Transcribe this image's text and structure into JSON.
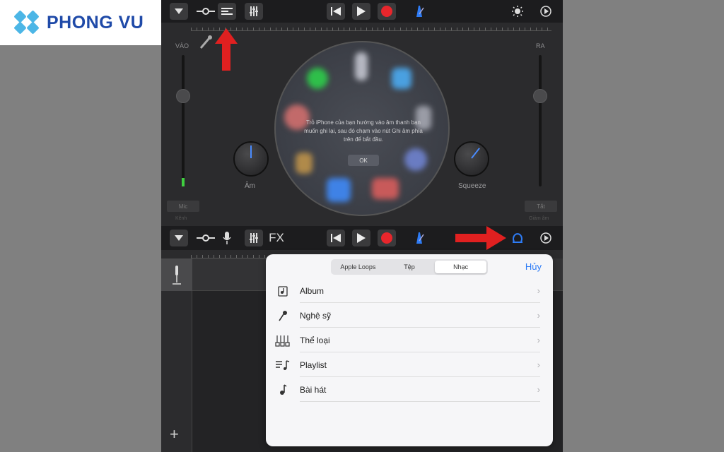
{
  "logo": {
    "text": "PHONG VU"
  },
  "input_panel": {
    "in_label": "VÀO",
    "out_label": "RA",
    "tone_label": "Âm",
    "squeeze_label": "Squeeze",
    "mic_label": "Mic",
    "channel_label": "Kênh",
    "hide_label": "Tắt",
    "noise_label": "Giảm âm",
    "message": "Trỏ iPhone của bạn hướng vào âm thanh bạn muốn ghi lại, sau đó chạm vào nút Ghi âm phía trên để bắt đầu.",
    "ok": "OK"
  },
  "bottom_toolbar": {
    "fx": "FX"
  },
  "browser": {
    "tabs": [
      {
        "label": "Apple Loops"
      },
      {
        "label": "Tệp"
      },
      {
        "label": "Nhạc"
      }
    ],
    "active_tab": "Nhạc",
    "cancel": "Hủy",
    "items": [
      {
        "label": "Album",
        "icon": "album-icon"
      },
      {
        "label": "Nghệ sỹ",
        "icon": "microphone-icon"
      },
      {
        "label": "Thể loại",
        "icon": "genre-icon"
      },
      {
        "label": "Playlist",
        "icon": "playlist-icon"
      },
      {
        "label": "Bài hát",
        "icon": "music-note-icon"
      }
    ]
  },
  "colors": {
    "record": "#e8262c",
    "accent": "#2e7cf6",
    "annotation": "#e02020"
  }
}
